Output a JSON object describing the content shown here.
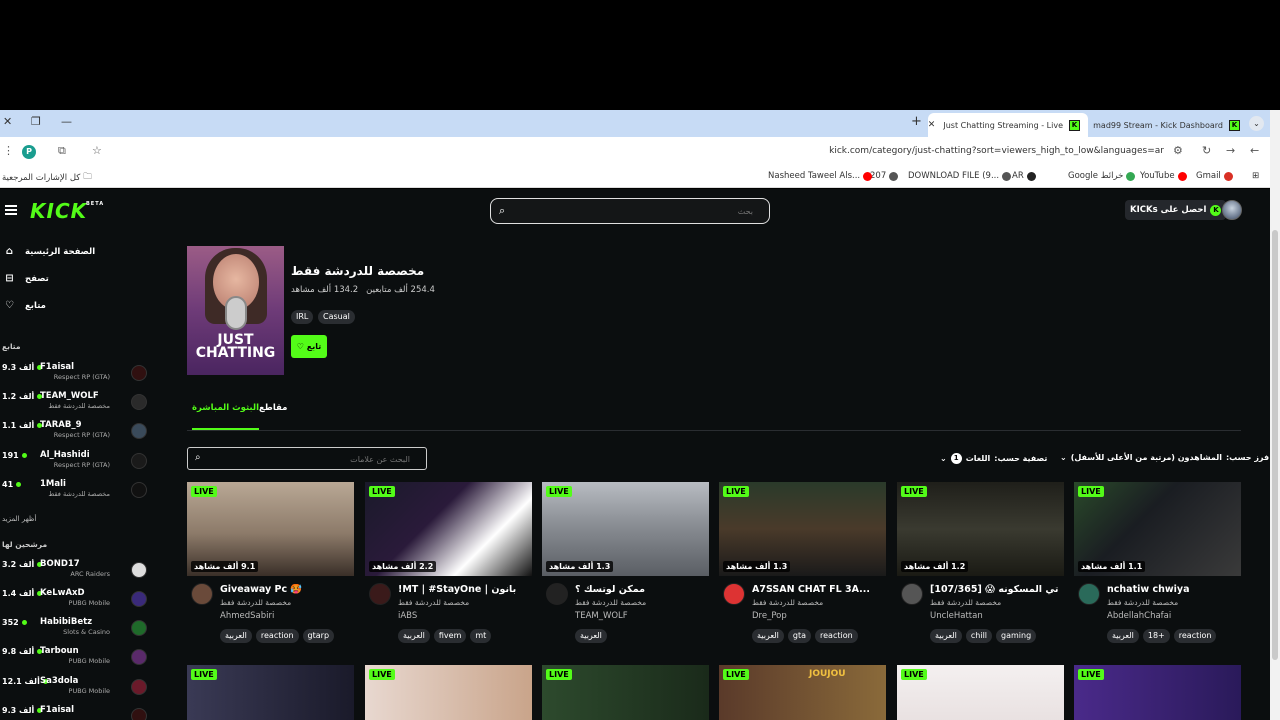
{
  "browser": {
    "tabs": [
      {
        "title": "Just Chatting Streaming - Live"
      },
      {
        "title": "mad99 Stream - Kick Dashboard"
      }
    ],
    "url": "kick.com/category/just-chatting?sort=viewers_high_to_low&languages=ar",
    "profile_letter": "P",
    "bookmarks": [
      {
        "label": "Gmail",
        "color": "#d93025"
      },
      {
        "label": "YouTube",
        "color": "#ff0000"
      },
      {
        "label": "Google خرائط",
        "color": "#34a853"
      },
      {
        "label": "AR",
        "color": "#222222"
      },
      {
        "label": "DOWNLOAD FILE (9...",
        "color": "#555555"
      },
      {
        "label": "207",
        "color": "#555555"
      },
      {
        "label": "Nasheed Taweel Als...",
        "color": "#ff0000"
      }
    ],
    "all_bookmarks": "كل الإشارات المرجعية"
  },
  "header": {
    "logo": "KICK",
    "logo_badge": "BETA",
    "search_placeholder": "بحث",
    "get_kicks": "احصل على KICKs",
    "get_kicks_icon": "K"
  },
  "sidebar": {
    "nav": [
      {
        "label": "الصفحة الرئيسية",
        "icon": "⌂"
      },
      {
        "label": "تصفح",
        "icon": "⊟"
      },
      {
        "label": "متابع",
        "icon": "♡"
      }
    ],
    "following_title": "متابع",
    "following": [
      {
        "count": "9.3 ألف",
        "name": "F1aisal",
        "category": "Respect RP (GTA)"
      },
      {
        "count": "1.2 ألف",
        "name": "TEAM_WOLF",
        "category": "مخصصة للدردشة فقط"
      },
      {
        "count": "1.1 ألف",
        "name": "TARAB_9",
        "category": "Respect RP (GTA)"
      },
      {
        "count": "191",
        "name": "Al_Hashidi",
        "category": "Respect RP (GTA)"
      },
      {
        "count": "41",
        "name": "1Mali",
        "category": "مخصصة للدردشة فقط"
      }
    ],
    "show_more": "أظهر المزيد",
    "recommended_title": "مرشحين لها",
    "recommended": [
      {
        "count": "3.2 ألف",
        "name": "BOND17",
        "category": "ARC Raiders"
      },
      {
        "count": "1.4 ألف",
        "name": "KeLwAxD",
        "category": "PUBG Mobile"
      },
      {
        "count": "352",
        "name": "HabibiBetz",
        "category": "Slots & Casino"
      },
      {
        "count": "9.8 ألف",
        "name": "Tarboun",
        "category": "PUBG Mobile"
      },
      {
        "count": "12.1 ألف",
        "name": "Sa3dola",
        "category": "PUBG Mobile"
      },
      {
        "count": "9.3 ألف",
        "name": "F1aisal",
        "category": ""
      }
    ]
  },
  "category": {
    "image_text": "JUST CHATTING",
    "title": "مخصصة للدردشة فقط",
    "followers": "254.4 ألف متابعين",
    "viewers": "134.2 ألف مشاهد",
    "tags": [
      "IRL",
      "Casual"
    ],
    "follow_label": "تابع",
    "tabs": [
      {
        "label": "البثوث المباشرة",
        "active": true
      },
      {
        "label": "مقاطع",
        "active": false
      }
    ],
    "tag_search_placeholder": "البحث عن علامات",
    "sort_label": "فرز حسب:",
    "sort_value": "المشاهدون (مرتبة من الأعلى للأسفل)",
    "filter_label": "تصفية حسب:",
    "language_label": "اللغات",
    "language_count": "1"
  },
  "streams": [
    {
      "live": "LIVE",
      "viewers": "9.1 ألف مشاهد",
      "title": "Giveaway Pc 🥵",
      "category": "مخصصة للدردشة فقط",
      "user": "AhmedSabiri",
      "tags": [
        "العربية",
        "reaction",
        "gtarp"
      ],
      "color": "#8c7a69"
    },
    {
      "live": "LIVE",
      "viewers": "2.2 ألف مشاهد",
      "title": "!MT | #StayOne | بانون",
      "category": "مخصصة للدردشة فقط",
      "user": "iABS",
      "tags": [
        "العربية",
        "fivem",
        "mt"
      ],
      "color": "#2a1a3a"
    },
    {
      "live": "LIVE",
      "viewers": "1.3 ألف مشاهد",
      "title": "ممكن لوتسك ؟",
      "category": "مخصصة للدردشة فقط",
      "user": "TEAM_WOLF",
      "tags": [
        "العربية"
      ],
      "color": "#7b7f85"
    },
    {
      "live": "LIVE",
      "viewers": "1.3 ألف مشاهد",
      "title": "A7SSAN CHAT FL 3A...",
      "category": "مخصصة للدردشة فقط",
      "user": "Dre_Pop",
      "tags": [
        "العربية",
        "gta",
        "reaction"
      ],
      "color": "#4a3a2a"
    },
    {
      "live": "LIVE",
      "viewers": "1.2 ألف مشاهد",
      "title": "[107/365] 😱 تي المسكونه",
      "category": "مخصصة للدردشة فقط",
      "user": "UncleHattan",
      "tags": [
        "العربية",
        "chill",
        "gaming"
      ],
      "color": "#2a2a24"
    },
    {
      "live": "LIVE",
      "viewers": "1.1 ألف مشاهد",
      "title": "nchatiw chwiya",
      "category": "مخصصة للدردشة فقط",
      "user": "AbdellahChafai",
      "tags": [
        "العربية",
        "18+",
        "reaction"
      ],
      "color": "#1a1d22"
    }
  ],
  "streams_row2": [
    {
      "live": "LIVE",
      "color": "#3a3a55"
    },
    {
      "live": "LIVE",
      "color": "#c9a48a"
    },
    {
      "live": "LIVE",
      "color": "#2d4a2d"
    },
    {
      "live": "LIVE",
      "color": "#5a3a2a"
    },
    {
      "live": "LIVE",
      "color": "#e8e0e0"
    },
    {
      "live": "LIVE",
      "color": "#4a2a8a"
    }
  ],
  "row2_banner": "JOUJOU"
}
